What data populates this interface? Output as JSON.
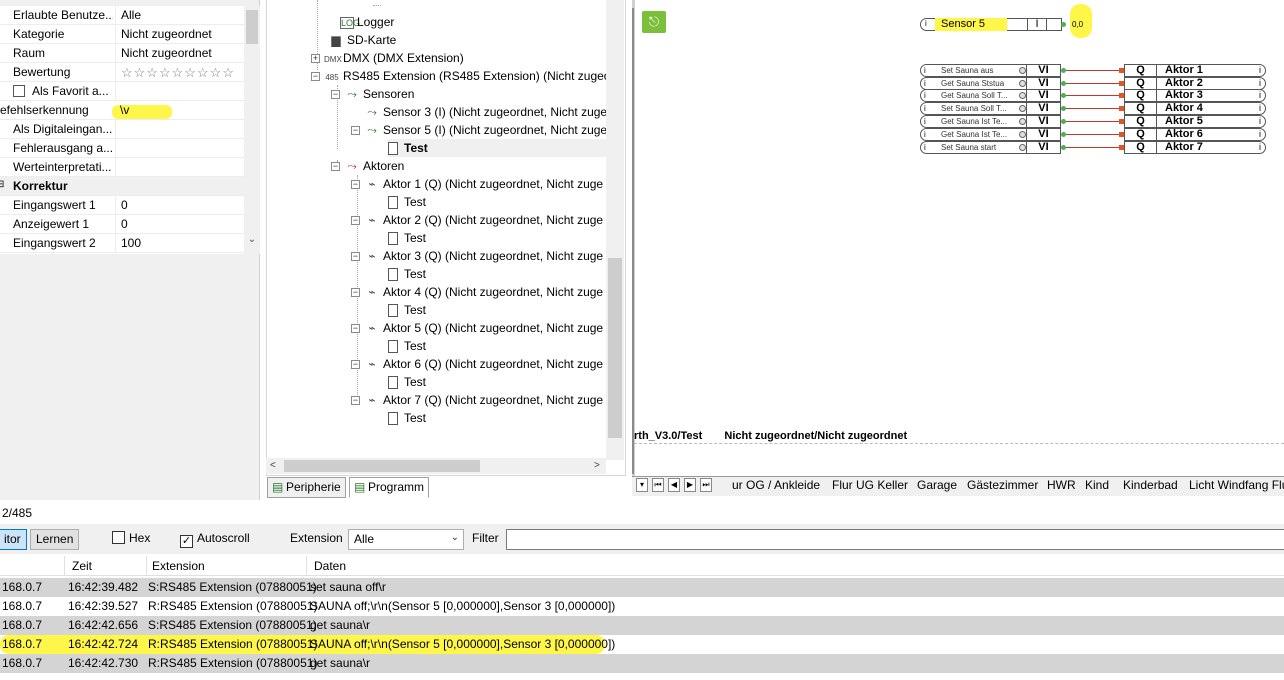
{
  "properties": {
    "rows": [
      {
        "name": "Erlaubte Benutze...",
        "value": "Alle"
      },
      {
        "name": "Kategorie",
        "value": "Nicht zugeordnet"
      },
      {
        "name": "Raum",
        "value": "Nicht zugeordnet"
      },
      {
        "name": "Bewertung",
        "value": "☆☆☆☆☆☆☆☆☆"
      },
      {
        "name": "Als Favorit a...",
        "value": ""
      },
      {
        "name": "efehlserkennung",
        "value": "\\v"
      },
      {
        "name": "Als Digitaleingan...",
        "value": ""
      },
      {
        "name": "Fehlerausgang a...",
        "value": ""
      },
      {
        "name": "Werteinterpretati...",
        "value": ""
      },
      {
        "name": "Korrektur",
        "value": ""
      },
      {
        "name": "Eingangswert 1",
        "value": "0"
      },
      {
        "name": "Anzeigewert 1",
        "value": "0"
      },
      {
        "name": "Eingangswert 2",
        "value": "100"
      }
    ],
    "status": "2/485"
  },
  "tree": {
    "items": [
      {
        "label": "Logger",
        "bold": false
      },
      {
        "label": "SD-Karte",
        "bold": false
      },
      {
        "label": "DMX (DMX Extension)",
        "bold": false
      },
      {
        "label": "RS485 Extension (RS485 Extension) (Nicht zugeord",
        "bold": false
      },
      {
        "label": "Sensoren",
        "bold": false
      },
      {
        "label": "Sensor 3 (I) (Nicht zugeordnet, Nicht zuge",
        "bold": false
      },
      {
        "label": "Sensor 5 (I) (Nicht zugeordnet, Nicht zuge",
        "bold": false
      },
      {
        "label": "Test",
        "bold": true
      },
      {
        "label": "Aktoren",
        "bold": false
      },
      {
        "label": "Aktor 1 (Q) (Nicht zugeordnet, Nicht zuge",
        "bold": false
      },
      {
        "label": "Test",
        "bold": false
      },
      {
        "label": "Aktor 2 (Q) (Nicht zugeordnet, Nicht zuge",
        "bold": false
      },
      {
        "label": "Test",
        "bold": false
      },
      {
        "label": "Aktor 3 (Q) (Nicht zugeordnet, Nicht zuge",
        "bold": false
      },
      {
        "label": "Test",
        "bold": false
      },
      {
        "label": "Aktor 4 (Q) (Nicht zugeordnet, Nicht zuge",
        "bold": false
      },
      {
        "label": "Test",
        "bold": false
      },
      {
        "label": "Aktor 5 (Q) (Nicht zugeordnet, Nicht zuge",
        "bold": false
      },
      {
        "label": "Test",
        "bold": false
      },
      {
        "label": "Aktor 6 (Q) (Nicht zugeordnet, Nicht zuge",
        "bold": false
      },
      {
        "label": "Test",
        "bold": false
      },
      {
        "label": "Aktor 7 (Q) (Nicht zugeordnet, Nicht zuge",
        "bold": false
      },
      {
        "label": "Test",
        "bold": false
      }
    ],
    "tabs": [
      "Peripherie",
      "Programm"
    ]
  },
  "canvas": {
    "sensor_block": {
      "label": "Sensor 5",
      "type": "I",
      "value": "0,0"
    },
    "inputs": [
      "Set Sauna aus",
      "Get Sauna Ststua",
      "Get Sauna Soll T...",
      "Set Sauna Soll T...",
      "Get Sauna Ist Te...",
      "Get Sauna Ist Te...",
      "Set Sauna start"
    ],
    "input_type": "VI",
    "outputs": [
      "Aktor 1",
      "Aktor 2",
      "Aktor 3",
      "Aktor 4",
      "Aktor 5",
      "Aktor 6",
      "Aktor 7"
    ],
    "output_type": "Q",
    "info_char": "i",
    "footer_path": "rth_V3.0/Test",
    "footer_assignment": "Nicht zugeordnet/Nicht zugeordnet",
    "page_tabs": [
      "ur OG / Ankleide",
      "Flur UG Keller",
      "Garage",
      "Gästezimmer",
      "HWR",
      "Kind",
      "Kinderbad",
      "Licht Windfang Flu"
    ]
  },
  "monitor": {
    "buttons": {
      "monitor": "itor",
      "learn": "Lernen"
    },
    "hex_label": "Hex",
    "autoscroll_label": "Autoscroll",
    "extension_label": "Extension",
    "extension_value": "Alle",
    "filter_label": "Filter",
    "columns": [
      "Zeit",
      "Extension",
      "Daten"
    ],
    "rows": [
      {
        "ip": "168.0.7",
        "time": "16:42:39.482",
        "ext": "S:RS485 Extension (07880051)",
        "data": "set sauna off\\r"
      },
      {
        "ip": "168.0.7",
        "time": "16:42:39.527",
        "ext": "R:RS485 Extension (07880051)",
        "data": "SAUNA off;\\r\\n(Sensor 5 [0,000000],Sensor 3 [0,000000])"
      },
      {
        "ip": "168.0.7",
        "time": "16:42:42.656",
        "ext": "S:RS485 Extension (07880051)",
        "data": "get sauna\\r"
      },
      {
        "ip": "168.0.7",
        "time": "16:42:42.724",
        "ext": "R:RS485 Extension (07880051)",
        "data": "SAUNA off;\\r\\n(Sensor 5 [0,000000],Sensor 3 [0,000000])"
      },
      {
        "ip": "168.0.7",
        "time": "16:42:42.730",
        "ext": "R:RS485 Extension (07880051)",
        "data": "get sauna\\r"
      }
    ]
  },
  "colors": {
    "highlight": "#fff64a",
    "accent_green": "#7cbf3a",
    "wire_red": "#c0392b"
  }
}
